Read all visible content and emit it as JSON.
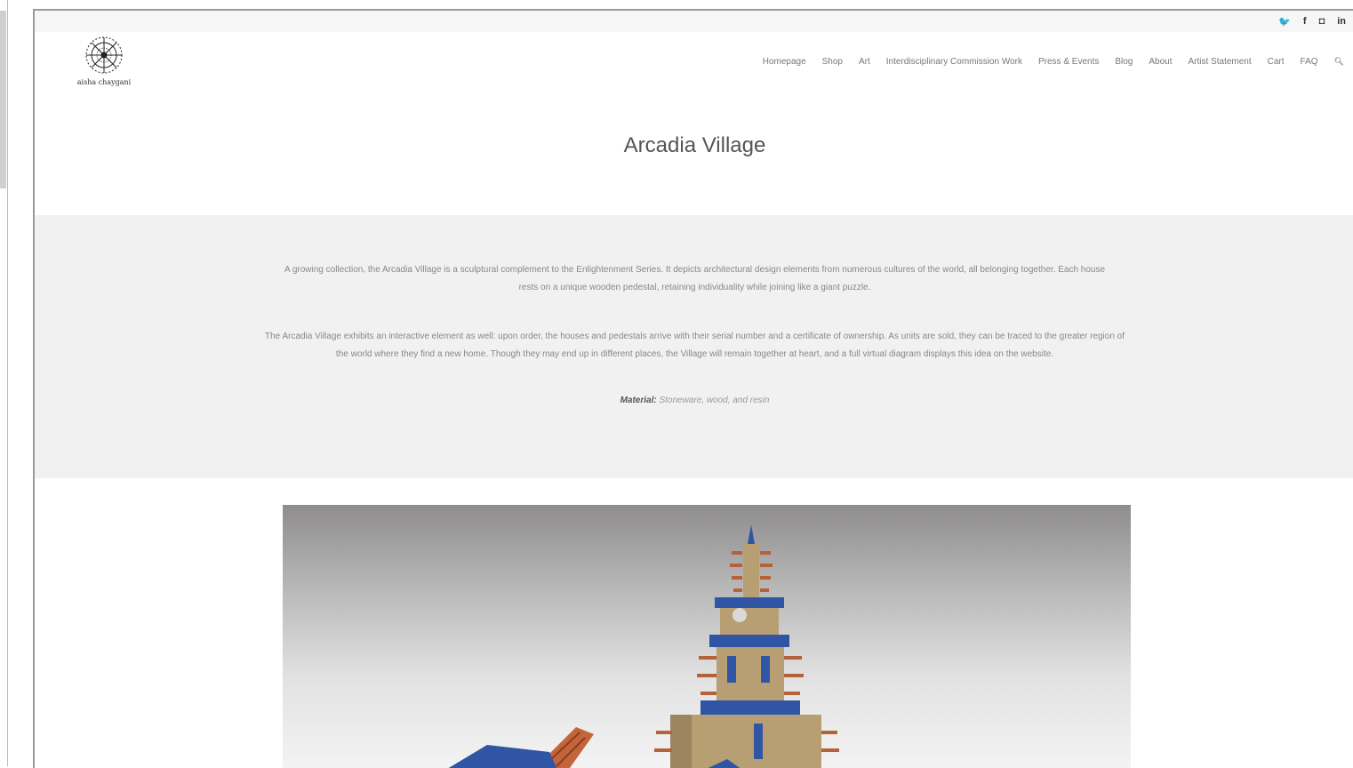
{
  "social": {
    "icons": [
      "twitter-icon",
      "facebook-icon",
      "instagram-icon",
      "linkedin-icon"
    ],
    "twitter_glyph": "🐦",
    "facebook_glyph": "f",
    "instagram_glyph": "◘",
    "linkedin_glyph": "in"
  },
  "brand": {
    "name": "aisha chaygani"
  },
  "nav": {
    "items": [
      "Homepage",
      "Shop",
      "Art",
      "Interdisciplinary Commission Work",
      "Press & Events",
      "Blog",
      "About",
      "Artist Statement",
      "Cart",
      "FAQ"
    ],
    "search_icon": "search-icon",
    "search_glyph": "🔍"
  },
  "page": {
    "title": "Arcadia Village"
  },
  "description": {
    "paragraph1": "A growing collection, the Arcadia Village is a sculptural complement to the Enlightenment Series. It depicts architectural design elements from numerous cultures of the world, all belonging together. Each house rests on a unique wooden pedestal, retaining individuality while joining like a giant puzzle.",
    "paragraph2": "The Arcadia Village exhibits an interactive element as well: upon order, the houses and pedestals arrive with their serial number and a certificate of ownership. As units are sold, they can be traced to the greater region of the world where they find a new home. Though they may end up in different places, the Village will remain together at heart, and a full virtual diagram displays this idea on the website.",
    "material_label": "Material:",
    "material_value": "Stoneware, wood, and resin"
  },
  "colors": {
    "band": "#f1f1f1",
    "accent_blue": "#2f55a4",
    "clay": "#b89f73",
    "rust": "#b5623a"
  }
}
